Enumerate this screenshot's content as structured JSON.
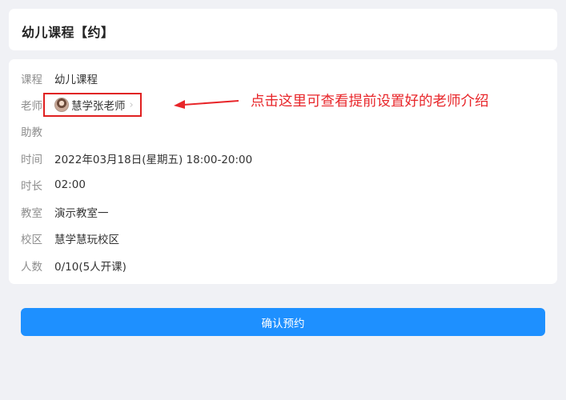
{
  "header": {
    "title": "幼儿课程【约】"
  },
  "details": {
    "course": {
      "label": "课程",
      "value": "幼儿课程"
    },
    "teacher": {
      "label": "老师",
      "value": "慧学张老师"
    },
    "assistant": {
      "label": "助教",
      "value": ""
    },
    "time": {
      "label": "时间",
      "value": "2022年03月18日(星期五) 18:00-20:00"
    },
    "duration": {
      "label": "时长",
      "value": "02:00"
    },
    "classroom": {
      "label": "教室",
      "value": "演示教室一"
    },
    "campus": {
      "label": "校区",
      "value": "慧学慧玩校区"
    },
    "capacity": {
      "label": "人数",
      "value": "0/10(5人开课)"
    }
  },
  "annotation": {
    "text": "点击这里可查看提前设置好的老师介绍",
    "color": "#e8262a"
  },
  "confirm_button": {
    "label": "确认预约",
    "color": "#1e90ff"
  }
}
